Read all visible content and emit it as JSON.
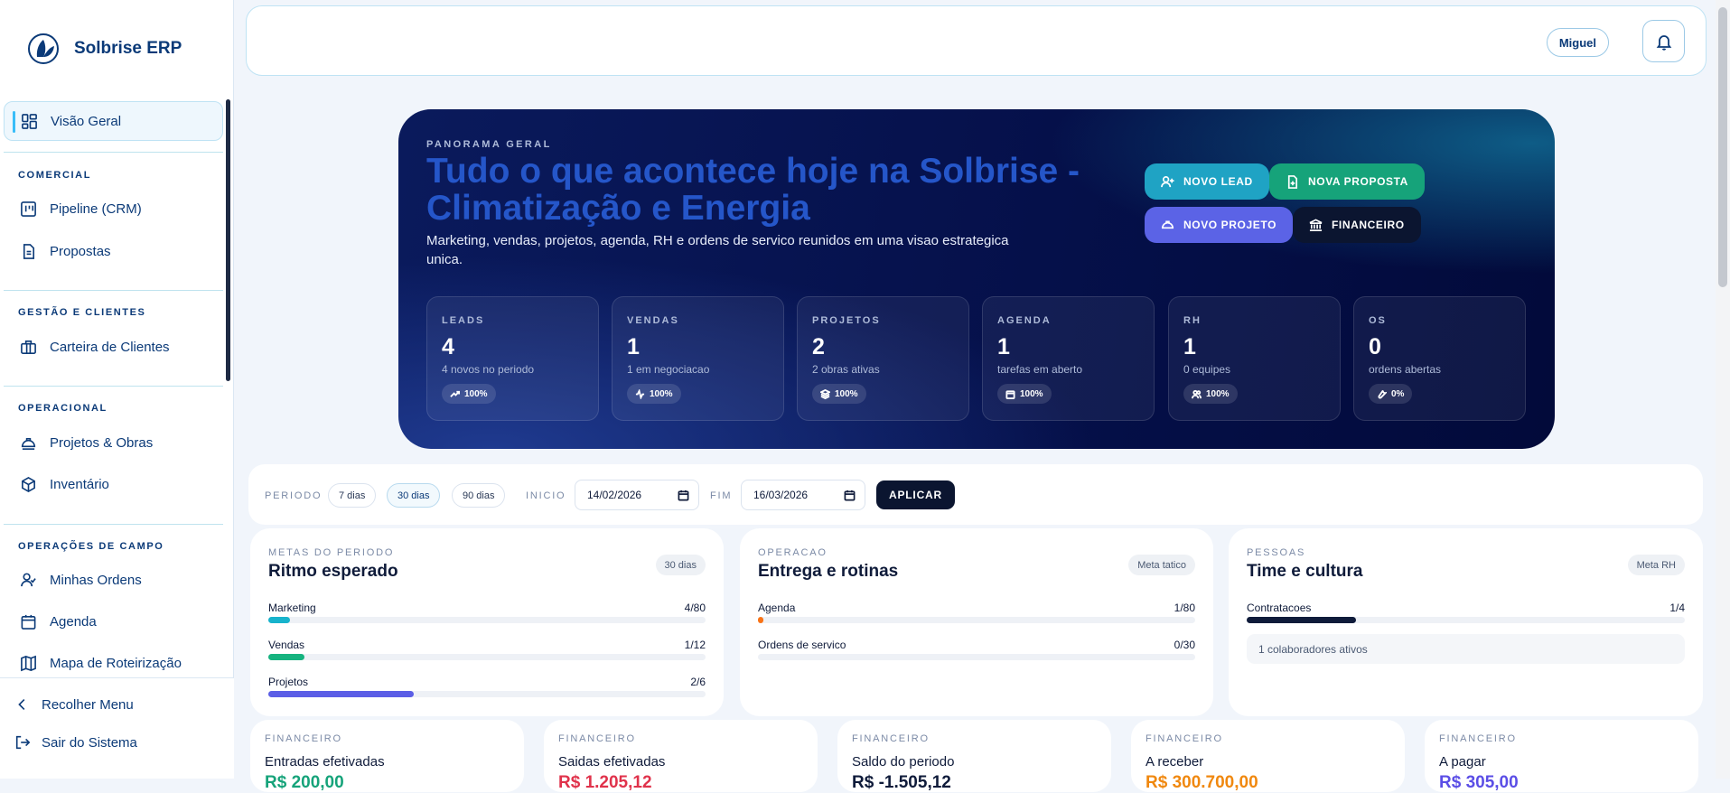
{
  "brand": {
    "name": "Solbrise ERP"
  },
  "sidebar": {
    "active": {
      "label": "Visão Geral",
      "icon": "dashboard-icon"
    },
    "sections": [
      {
        "title": "COMERCIAL",
        "items": [
          {
            "label": "Pipeline (CRM)",
            "icon": "kanban-icon"
          },
          {
            "label": "Propostas",
            "icon": "document-icon"
          }
        ]
      },
      {
        "title": "GESTÃO E CLIENTES",
        "items": [
          {
            "label": "Carteira de Clientes",
            "icon": "briefcase-icon"
          }
        ]
      },
      {
        "title": "OPERACIONAL",
        "items": [
          {
            "label": "Projetos & Obras",
            "icon": "hardhat-icon"
          },
          {
            "label": "Inventário",
            "icon": "box-icon"
          }
        ]
      },
      {
        "title": "OPERAÇÕES DE CAMPO",
        "items": [
          {
            "label": "Minhas Ordens",
            "icon": "user-check-icon"
          },
          {
            "label": "Agenda",
            "icon": "calendar-icon"
          },
          {
            "label": "Mapa de Roteirização",
            "icon": "map-icon"
          }
        ]
      }
    ],
    "collapse_label": "Recolher Menu",
    "logout_label": "Sair do Sistema"
  },
  "topbar": {
    "user": "Miguel",
    "bell_icon": "bell-icon"
  },
  "hero": {
    "eyebrow": "PANORAMA GERAL",
    "title": "Tudo o que acontece hoje na Solbrise - Climatização e Energia",
    "subtitle": "Marketing, vendas, projetos, agenda, RH e ordens de servico reunidos em uma visao estrategica unica.",
    "buttons": {
      "new_lead": "NOVO LEAD",
      "new_proposal": "NOVA PROPOSTA",
      "new_project": "NOVO PROJETO",
      "finance": "FINANCEIRO"
    },
    "colors": {
      "lead": "#1fa3c4",
      "proposal": "#16a37a",
      "project": "#5b63e6",
      "finance": "#0b1530"
    },
    "stats": [
      {
        "label": "LEADS",
        "value": "4",
        "desc": "4 novos no periodo",
        "badge": "100%",
        "icon": "trend-up-icon"
      },
      {
        "label": "VENDAS",
        "value": "1",
        "desc": "1 em negociacao",
        "badge": "100%",
        "icon": "activity-icon"
      },
      {
        "label": "PROJETOS",
        "value": "2",
        "desc": "2 obras ativas",
        "badge": "100%",
        "icon": "layers-icon"
      },
      {
        "label": "AGENDA",
        "value": "1",
        "desc": "tarefas em aberto",
        "badge": "100%",
        "icon": "calendar-icon"
      },
      {
        "label": "RH",
        "value": "1",
        "desc": "0 equipes",
        "badge": "100%",
        "icon": "users-icon"
      },
      {
        "label": "OS",
        "value": "0",
        "desc": "ordens abertas",
        "badge": "0%",
        "icon": "wrench-icon"
      }
    ]
  },
  "filter": {
    "period_label": "PERIODO",
    "chips": [
      "7 dias",
      "30 dias",
      "90 dias"
    ],
    "selected_chip": "30 dias",
    "start_label": "INICIO",
    "start_value": "14/02/2026",
    "end_label": "FIM",
    "end_value": "16/03/2026",
    "apply_label": "APLICAR"
  },
  "goals": [
    {
      "eyebrow": "METAS DO PERIODO",
      "title": "Ritmo esperado",
      "badge": "30 dias",
      "metrics": [
        {
          "name": "Marketing",
          "value": "4/80",
          "progress": 0.05,
          "color": "#17b3cc"
        },
        {
          "name": "Vendas",
          "value": "1/12",
          "progress": 0.083,
          "color": "#16b37f"
        },
        {
          "name": "Projetos",
          "value": "2/6",
          "progress": 0.333,
          "color": "#5b5ee6"
        }
      ]
    },
    {
      "eyebrow": "OPERACAO",
      "title": "Entrega e rotinas",
      "badge": "Meta tatico",
      "metrics": [
        {
          "name": "Agenda",
          "value": "1/80",
          "progress": 0.0125,
          "color": "#f97316"
        },
        {
          "name": "Ordens de servico",
          "value": "0/30",
          "progress": 0,
          "color": "#f97316"
        }
      ]
    },
    {
      "eyebrow": "PESSOAS",
      "title": "Time e cultura",
      "badge": "Meta RH",
      "metrics": [
        {
          "name": "Contratacoes",
          "value": "1/4",
          "progress": 0.25,
          "color": "#0f1b3a"
        }
      ],
      "note": "1 colaboradores ativos"
    }
  ],
  "finance": [
    {
      "eyebrow": "FINANCEIRO",
      "title": "Entradas efetivadas",
      "value": "R$ 200,00",
      "color": "#16a37a"
    },
    {
      "eyebrow": "FINANCEIRO",
      "title": "Saidas efetivadas",
      "value": "R$ 1.205,12",
      "color": "#e0324b"
    },
    {
      "eyebrow": "FINANCEIRO",
      "title": "Saldo do periodo",
      "value": "R$ -1.505,12",
      "color": "#0f1b3a"
    },
    {
      "eyebrow": "FINANCEIRO",
      "title": "A receber",
      "value": "R$ 300.700,00",
      "color": "#f0880f"
    },
    {
      "eyebrow": "FINANCEIRO",
      "title": "A pagar",
      "value": "R$ 305,00",
      "color": "#5b4ee6"
    }
  ]
}
